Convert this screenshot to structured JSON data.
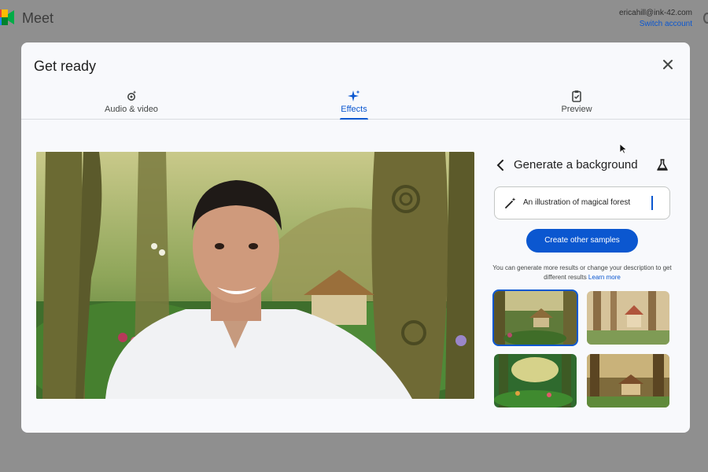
{
  "app": {
    "name": "Meet"
  },
  "account": {
    "email": "ericahill@ink-42.com",
    "switch_label": "Switch account"
  },
  "dialog": {
    "title": "Get ready",
    "tabs": [
      {
        "label": "Audio & video",
        "icon": "gear-sparkle-icon",
        "active": false
      },
      {
        "label": "Effects",
        "icon": "sparkle-icon",
        "active": true
      },
      {
        "label": "Preview",
        "icon": "clipboard-icon",
        "active": false
      }
    ]
  },
  "panel": {
    "title": "Generate a background",
    "prompt_value": "An illustration of magical forest",
    "create_button": "Create other samples",
    "helper_text": "You can generate more results or change your description to get different results",
    "learn_more": "Learn more",
    "samples_selected_index": 0
  },
  "colors": {
    "accent": "#0b57d0",
    "dialog_bg": "#f8f9fc",
    "overlay": "#8f8f8f"
  }
}
